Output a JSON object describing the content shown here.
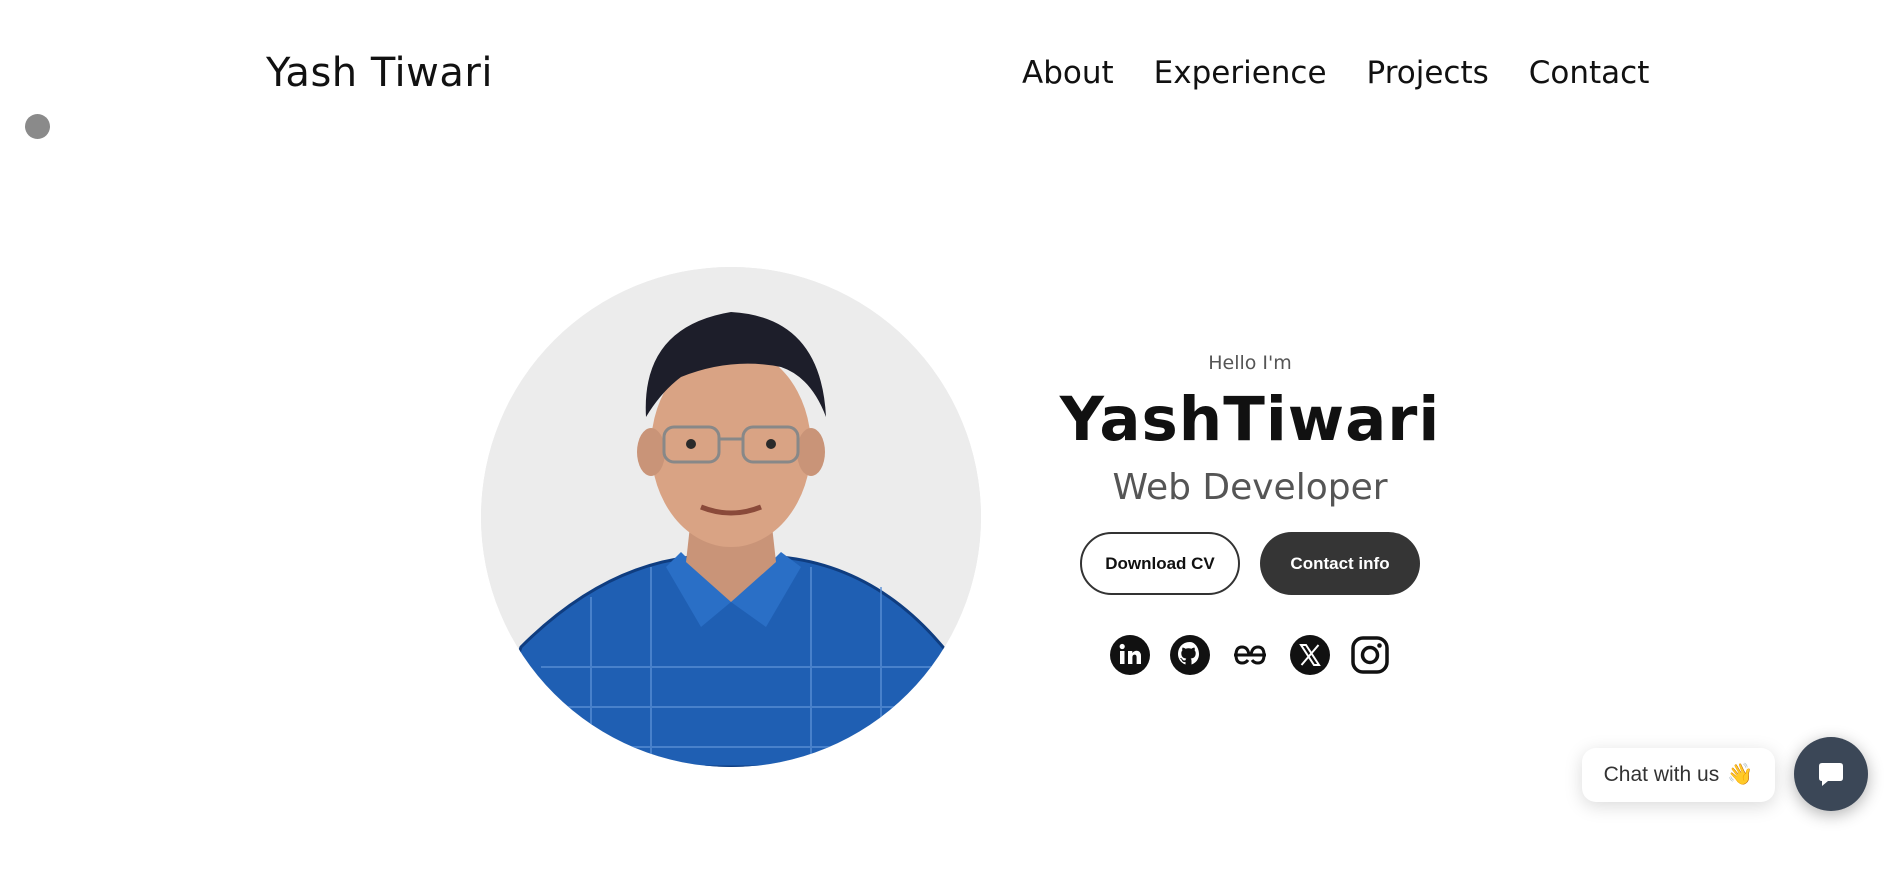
{
  "header": {
    "brand": "Yash Tiwari",
    "nav": [
      "About",
      "Experience",
      "Projects",
      "Contact"
    ]
  },
  "hero": {
    "greeting": "Hello I'm",
    "name": "YashTiwari",
    "role": "Web Developer",
    "buttons": {
      "download": "Download CV",
      "contact": "Contact info"
    },
    "socials": [
      "linkedin-icon",
      "github-icon",
      "geeksforgeeks-icon",
      "x-icon",
      "instagram-icon"
    ]
  },
  "chat": {
    "label": "Chat with us",
    "emoji": "👋"
  },
  "colors": {
    "dark_button": "#353535",
    "chat_launcher": "#3b4757",
    "shirt": "#1f5fb3"
  }
}
